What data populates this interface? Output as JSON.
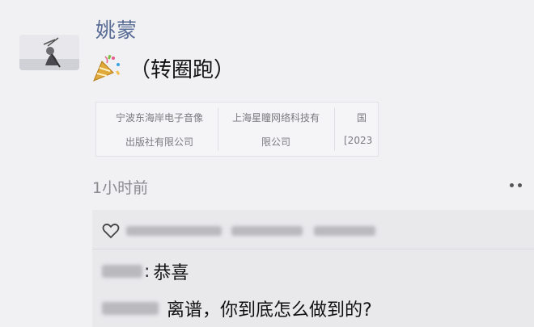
{
  "post": {
    "author": "姚蒙",
    "content": "（转圈跑）",
    "emoji_icon": "party-popper-icon",
    "time": "1小时前"
  },
  "link_card": {
    "columns": [
      {
        "line1": "宁波东海岸电子音像",
        "line2": "出版社有限公司"
      },
      {
        "line1": "上海星瞳网络科技有",
        "line2": "限公司"
      },
      {
        "line1": "国",
        "line2": "[2023"
      }
    ]
  },
  "comments": {
    "like_icon": "heart-outline-icon",
    "items": [
      {
        "separator": ":",
        "text": "恭喜"
      },
      {
        "separator": ":",
        "text": "离谱，你到底怎么做到的?"
      }
    ]
  },
  "colors": {
    "author_link": "#576b95",
    "background": "#f1f1f3",
    "comments_bg": "#e9e9ec"
  }
}
